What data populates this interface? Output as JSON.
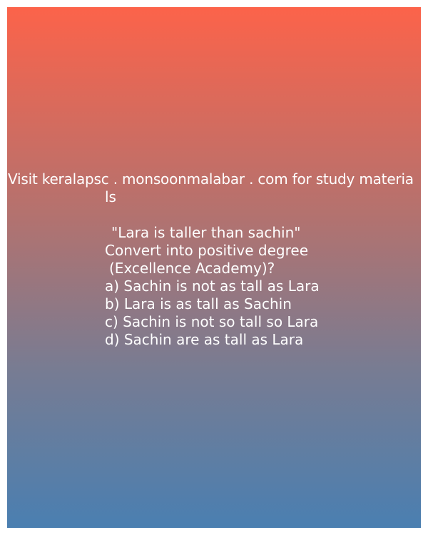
{
  "promo": {
    "line1": "Visit keralapsc . monsoonmalabar . com for study materia",
    "line2": "ls"
  },
  "question": {
    "quote": "\"Lara is taller than sachin\"",
    "instruction": "Convert into positive degree",
    "source": "(Excellence Academy)?"
  },
  "options": [
    "a) Sachin is not as tall as Lara",
    "b) Lara is as tall as Sachin",
    "c) Sachin is not so tall so Lara",
    "d) Sachin are as tall as Lara"
  ],
  "colors": {
    "gradient_top": "#fc634a",
    "gradient_bottom": "#4a7fb1",
    "text": "#ffffff"
  }
}
